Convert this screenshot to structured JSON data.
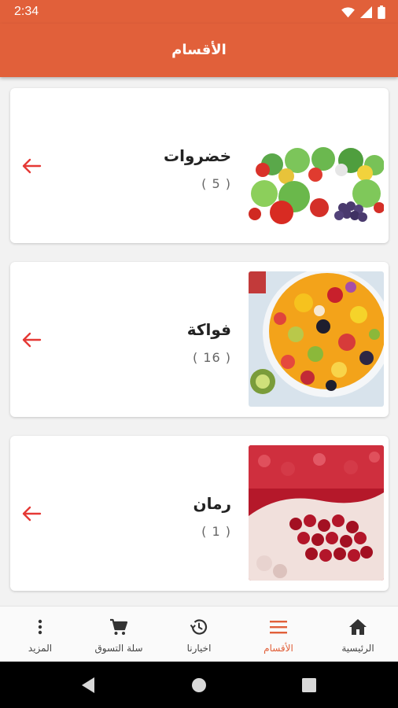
{
  "status": {
    "time": "2:34"
  },
  "header": {
    "title": "الأقسام"
  },
  "categories": [
    {
      "name": "خضروات",
      "count": "( 5 )",
      "image": "vegetables-image"
    },
    {
      "name": "فواكة",
      "count": "( 16 )",
      "image": "fruit-salad-image"
    },
    {
      "name": "رمان",
      "count": "( 1 )",
      "image": "pomegranate-image"
    }
  ],
  "nav": {
    "items": [
      {
        "label": "المزيد",
        "icon": "more-vert-icon",
        "active": false
      },
      {
        "label": "سلة التسوق",
        "icon": "cart-icon",
        "active": false
      },
      {
        "label": "اخيارنا",
        "icon": "history-icon",
        "active": false
      },
      {
        "label": "الأقسام",
        "icon": "menu-icon",
        "active": true
      },
      {
        "label": "الرئيسية",
        "icon": "home-icon",
        "active": false
      }
    ]
  },
  "colors": {
    "primary": "#e1603a",
    "arrow": "#e53935",
    "background": "#f2f2f2"
  }
}
